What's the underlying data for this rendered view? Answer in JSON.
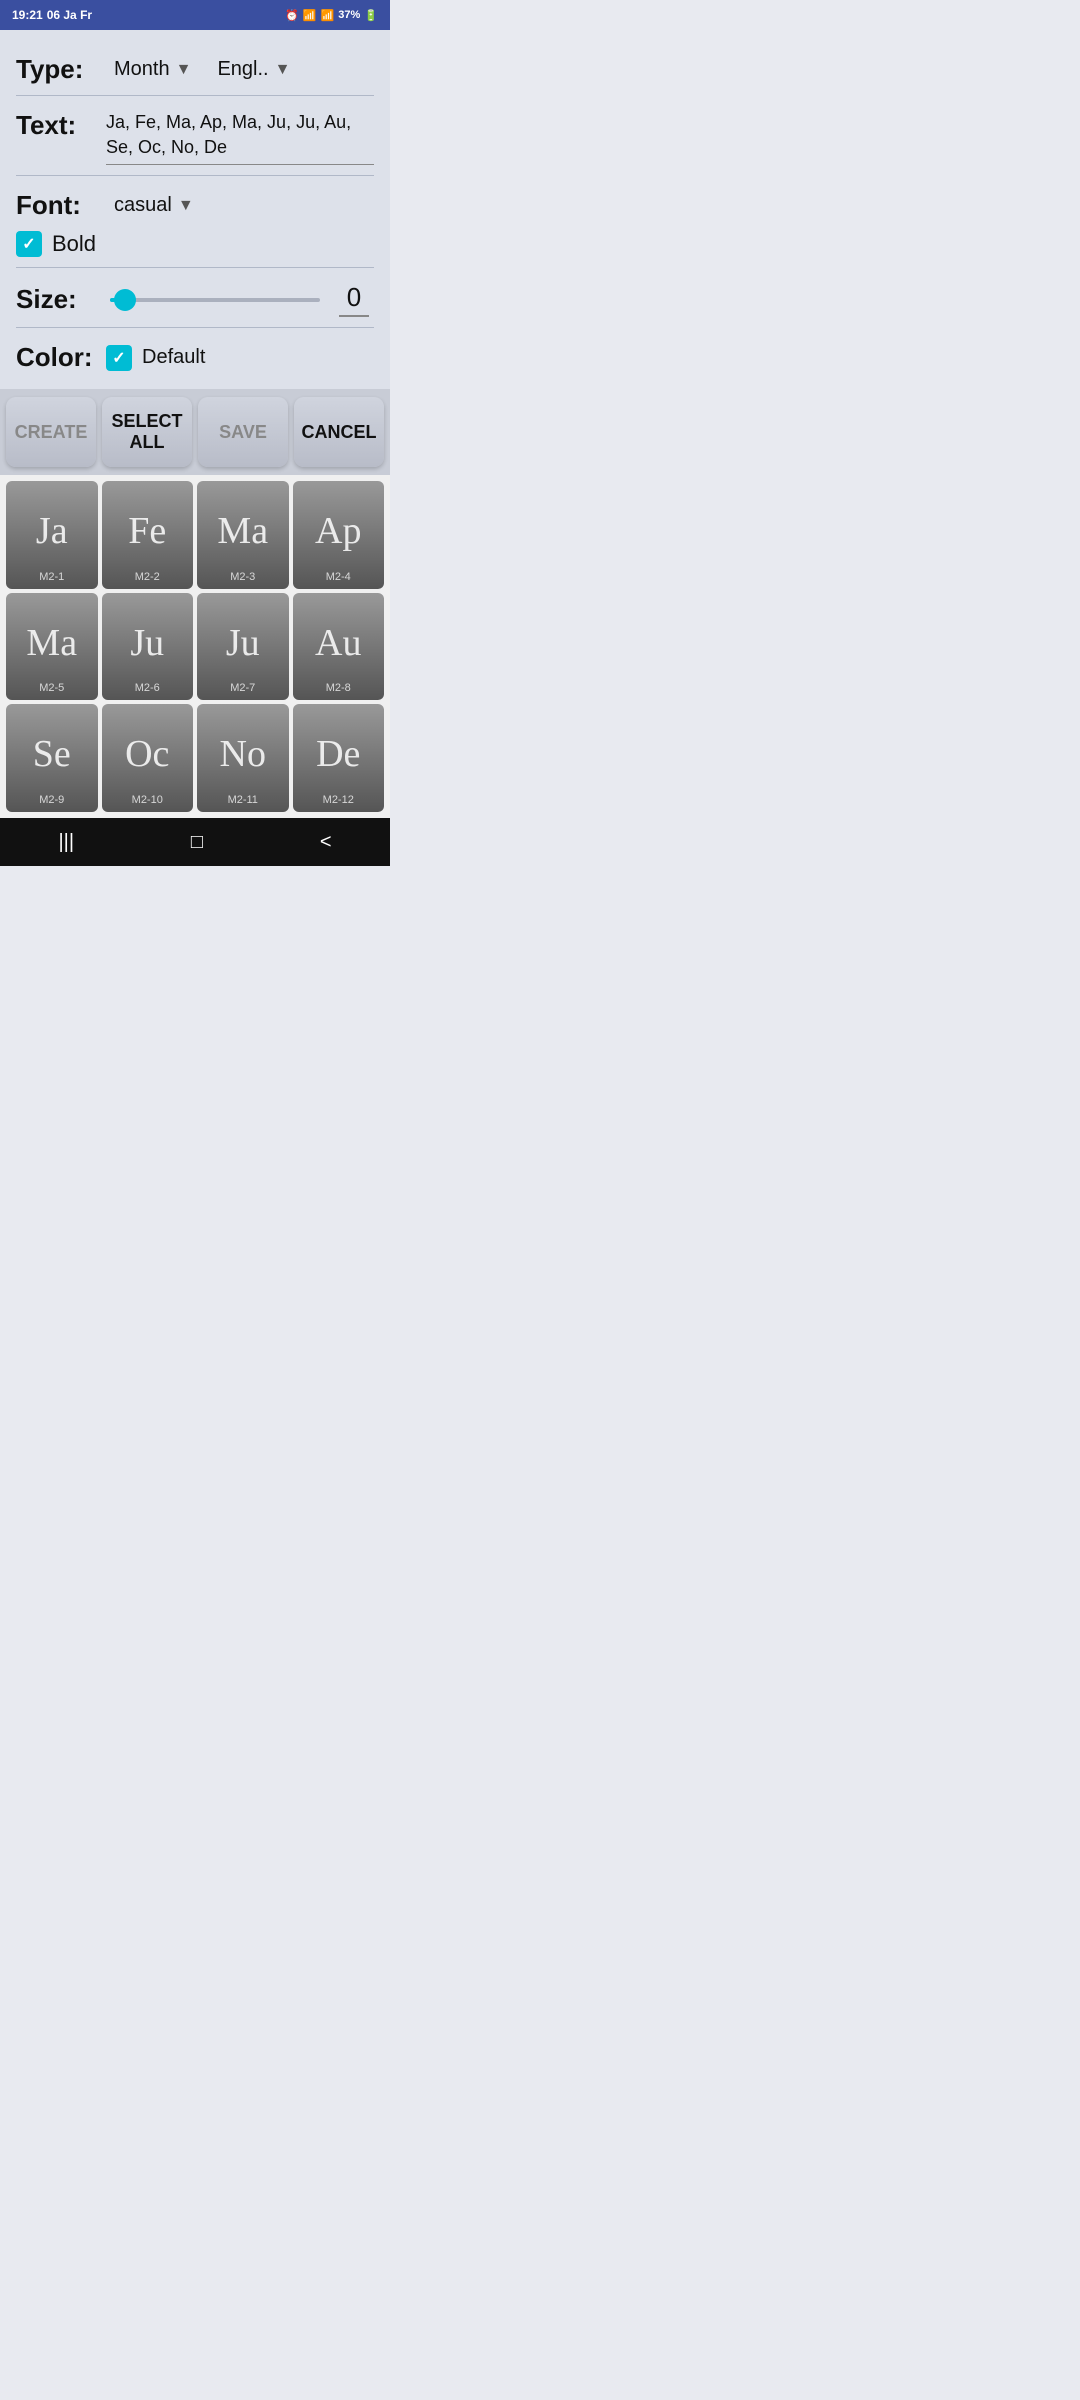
{
  "statusBar": {
    "time": "19:21",
    "date": "06 Ja Fr",
    "battery": "37%"
  },
  "typeRow": {
    "label": "Type:",
    "typeValue": "Month",
    "langValue": "Engl.."
  },
  "textRow": {
    "label": "Text:",
    "value": "Ja, Fe, Ma, Ap, Ma, Ju, Ju, Au, Se, Oc, No, De"
  },
  "fontRow": {
    "label": "Font:",
    "fontValue": "casual",
    "boldLabel": "Bold",
    "boldChecked": true
  },
  "sizeRow": {
    "label": "Size:",
    "value": "0",
    "sliderPercent": 6
  },
  "colorRow": {
    "label": "Color:",
    "defaultLabel": "Default",
    "defaultChecked": true
  },
  "buttons": {
    "create": "CREATE",
    "selectAll": "SELECT ALL",
    "save": "SAVE",
    "cancel": "CANCEL"
  },
  "tiles": [
    {
      "id": "M2-1",
      "text": "Ja"
    },
    {
      "id": "M2-2",
      "text": "Fe"
    },
    {
      "id": "M2-3",
      "text": "Ma"
    },
    {
      "id": "M2-4",
      "text": "Ap"
    },
    {
      "id": "M2-5",
      "text": "Ma"
    },
    {
      "id": "M2-6",
      "text": "Ju"
    },
    {
      "id": "M2-7",
      "text": "Ju"
    },
    {
      "id": "M2-8",
      "text": "Au"
    },
    {
      "id": "M2-9",
      "text": "Se"
    },
    {
      "id": "M2-10",
      "text": "Oc"
    },
    {
      "id": "M2-11",
      "text": "No"
    },
    {
      "id": "M2-12",
      "text": "De"
    }
  ],
  "nav": {
    "recentIcon": "|||",
    "homeIcon": "□",
    "backIcon": "<"
  }
}
